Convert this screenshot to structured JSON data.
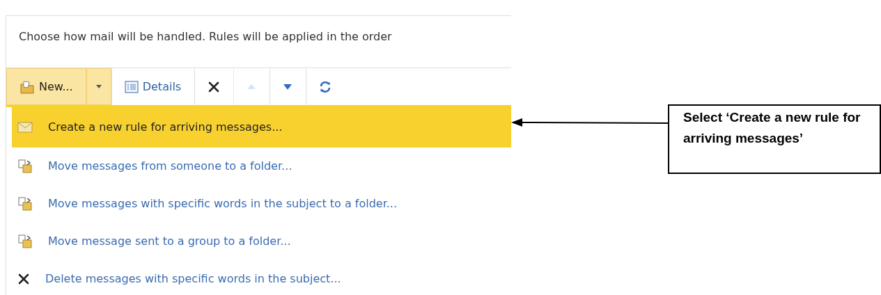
{
  "description": "Choose how mail will be handled. Rules will be applied in the order",
  "toolbar": [
    {
      "kind": "new",
      "label": "New...",
      "hovered": true,
      "disabled": false
    },
    {
      "kind": "caret",
      "hovered": true,
      "disabled": false
    },
    {
      "kind": "details",
      "label": "Details",
      "hovered": false,
      "disabled": false
    },
    {
      "kind": "delete",
      "hovered": false,
      "disabled": false
    },
    {
      "kind": "up",
      "hovered": false,
      "disabled": true
    },
    {
      "kind": "down",
      "hovered": false,
      "disabled": false
    },
    {
      "kind": "refresh",
      "hovered": false,
      "disabled": false
    }
  ],
  "menu": [
    {
      "kind": "envelope",
      "label": "Create a new rule for arriving messages...",
      "selected": true
    },
    {
      "kind": "move",
      "label": "Move messages from someone to a folder...",
      "selected": false
    },
    {
      "kind": "move",
      "label": "Move messages with specific words in the subject to a folder...",
      "selected": false
    },
    {
      "kind": "move",
      "label": "Move message sent to a group to a folder...",
      "selected": false
    },
    {
      "kind": "delete",
      "label": "Delete messages with specific words in the subject...",
      "selected": false
    }
  ],
  "callout": "Select ‘Create a new rule for arriving messages’"
}
